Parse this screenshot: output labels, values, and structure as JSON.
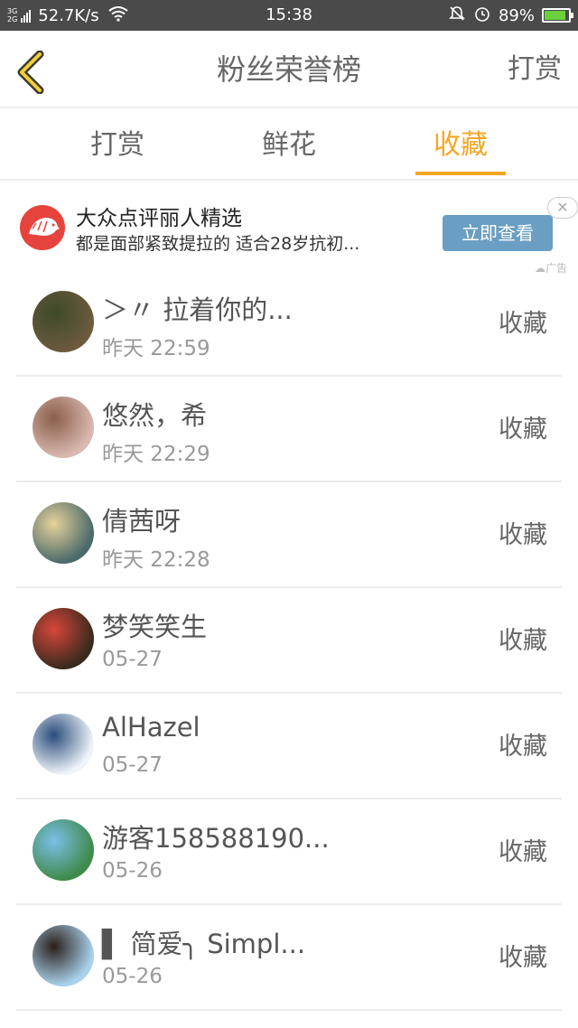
{
  "status_bar": {
    "network_top": "3G",
    "network_bottom": "2G",
    "speed": "52.7K/s",
    "time": "15:38",
    "battery": "89%",
    "battery_level": 0.89
  },
  "header": {
    "title": "粉丝荣誉榜",
    "right_action": "打赏"
  },
  "tabs": [
    {
      "label": "打赏",
      "active": false
    },
    {
      "label": "鲜花",
      "active": false
    },
    {
      "label": "收藏",
      "active": true
    }
  ],
  "ad": {
    "title": "大众点评丽人精选",
    "description": "都是面部紧致提拉的 适合28岁抗初...",
    "button": "立即查看",
    "close": "✕",
    "tag": "广告"
  },
  "list": [
    {
      "name": "＞〃 拉着你的...",
      "time": "昨天 22:59",
      "action": "收藏",
      "avatar_color": "#6b5a3c",
      "avatar_accent": "#3d4a2a"
    },
    {
      "name": "悠然，希",
      "time": "昨天 22:29",
      "action": "收藏",
      "avatar_color": "#d9b8b0",
      "avatar_accent": "#8a5e4a"
    },
    {
      "name": "倩茜呀",
      "time": "昨天 22:28",
      "action": "收藏",
      "avatar_color": "#4b6a6a",
      "avatar_accent": "#e6d29a"
    },
    {
      "name": "梦笑笑生",
      "time": "05-27",
      "action": "收藏",
      "avatar_color": "#3a2a1e",
      "avatar_accent": "#d7463a"
    },
    {
      "name": "AlHazel",
      "time": "05-27",
      "action": "收藏",
      "avatar_color": "#eef4fa",
      "avatar_accent": "#2a4d7a"
    },
    {
      "name": "游客158588190...",
      "time": "05-26",
      "action": "收藏",
      "avatar_color": "#3f8a4a",
      "avatar_accent": "#7bbfe8"
    },
    {
      "name": "▌ 简爱╮ Simpl...",
      "time": "05-26",
      "action": "收藏",
      "avatar_color": "#a8d2ec",
      "avatar_accent": "#2b1f1a"
    }
  ]
}
